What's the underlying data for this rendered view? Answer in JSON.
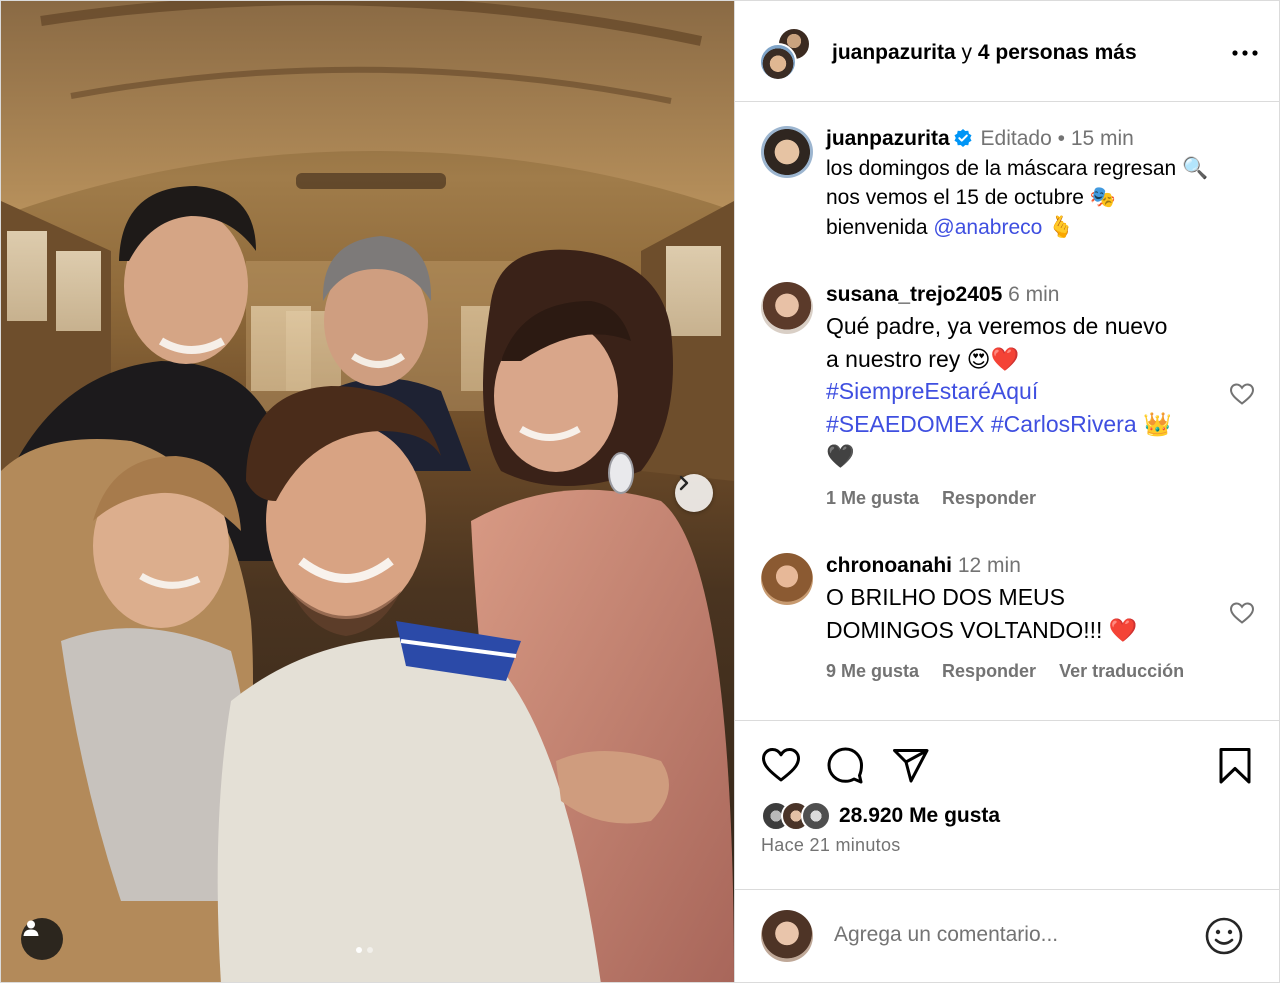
{
  "header": {
    "username": "juanpazurita",
    "conjunction": "y",
    "others": "4 personas más",
    "more_icon": "more-horizontal-icon"
  },
  "caption": {
    "username": "juanpazurita",
    "edited": "Editado",
    "separator": "•",
    "time": "15 min",
    "line1": "los domingos de la máscara regresan 🔍",
    "line2": "nos vemos el 15 de octubre 🎭",
    "line3_prefix": "bienvenida ",
    "mention": "@anabreco",
    "line3_suffix": " 🫰"
  },
  "comments": [
    {
      "username": "susana_trejo2405",
      "time": "6 min",
      "text_line1": "Qué padre, ya veremos de nuevo",
      "text_line2": "a nuestro rey 😍❤️",
      "hashtag1": "#SiempreEstaréAquí",
      "hashtag2": "#SEAEDOMEX",
      "hashtag3": "#CarlosRivera",
      "tail_emoji": "👑",
      "last_line": "🖤",
      "likes": "1 Me gusta",
      "reply": "Responder"
    },
    {
      "username": "chronoanahi",
      "time": "12 min",
      "text_line1": "O BRILHO DOS MEUS",
      "text_line2": "DOMINGOS VOLTANDO!!! ❤️",
      "likes": "9 Me gusta",
      "reply": "Responder",
      "translate": "Ver traducción"
    }
  ],
  "footer": {
    "likes_count": "28.920 Me gusta",
    "time_ago": "Hace 21 minutos",
    "comment_placeholder": "Agrega un comentario..."
  },
  "colors": {
    "link": "#3f4fe0",
    "meta": "#737373",
    "border": "#dbdbdb",
    "verified": "#0095f6",
    "heart_red": "#ed4956"
  },
  "icons": [
    "heart-icon",
    "comment-icon",
    "share-icon",
    "bookmark-icon",
    "chevron-right-icon",
    "tag-user-icon",
    "emoji-icon",
    "verified-badge-icon"
  ]
}
